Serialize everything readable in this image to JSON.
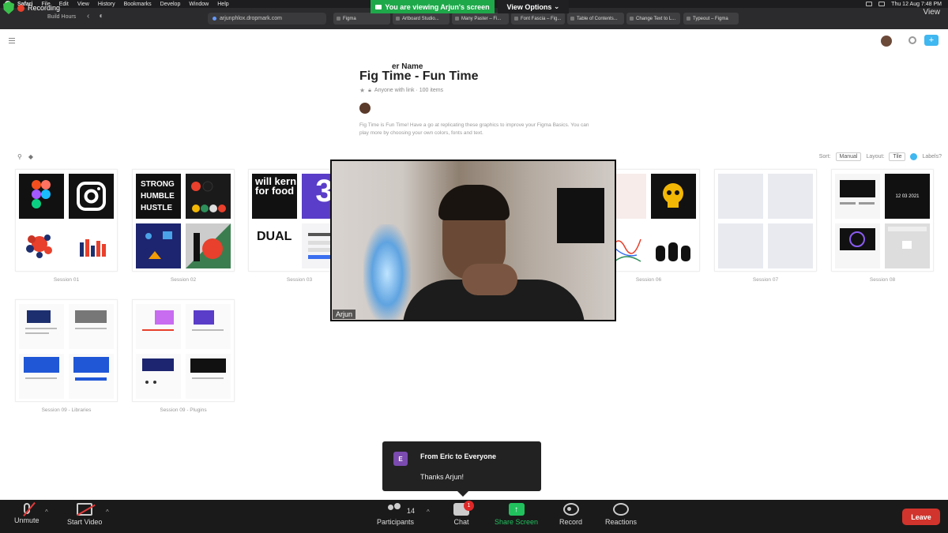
{
  "menubar": {
    "app": "Safari",
    "items": [
      "File",
      "Edit",
      "View",
      "History",
      "Bookmarks",
      "Develop",
      "Window",
      "Help"
    ],
    "clock": "Thu 12 Aug  7:48 PM"
  },
  "recording": {
    "label": "Recording"
  },
  "browser": {
    "sidebar_label": "Build Hours",
    "url": "arjunphlox.dropmark.com",
    "tabs": [
      "Figma",
      "Artboard Studio...",
      "Many Paster – Fi...",
      "Font Fascia – Fig...",
      "Table of Contents...",
      "Change Text to L...",
      "Typeout – Figma"
    ]
  },
  "zoom_share": {
    "banner": "You are viewing Arjun's screen",
    "view_options": "View Options",
    "view_button": "View"
  },
  "page": {
    "ghost_text": "er Name",
    "title": "Fig Time - Fun Time",
    "meta": "Anyone with link · 100 items",
    "description": "Fig Time is Fun Time! Have a go at replicating these graphics to improve your Figma Basics. You can play more by choosing your own colors, fonts and text.",
    "sort_label": "Sort:",
    "sort_value": "Manual",
    "layout_label": "Layout:",
    "layout_value": "Tile",
    "labels_toggle": "Labels?"
  },
  "collections": [
    {
      "label": "Session 01"
    },
    {
      "label": "Session 02"
    },
    {
      "label": "Session 03"
    },
    {
      "label": "Session 06"
    },
    {
      "label": "Session 07"
    },
    {
      "label": "Session 08"
    },
    {
      "label": "Session 09 - Libraries"
    },
    {
      "label": "Session 09 - Plugins"
    }
  ],
  "thumb_text": {
    "strong": "STRONG",
    "humble": "HUMBLE",
    "hustle": "HUSTLE",
    "will_kern": "will kern for food",
    "dual": "DUAL",
    "date": "12 03 2021"
  },
  "video": {
    "participant": "Arjun"
  },
  "chat_toast": {
    "avatar_initial": "E",
    "from": "From Eric to Everyone",
    "message": "Thanks Arjun!"
  },
  "controls": {
    "unmute": "Unmute",
    "start_video": "Start Video",
    "participants": "Participants",
    "participants_count": "14",
    "chat": "Chat",
    "chat_badge": "1",
    "share_screen": "Share Screen",
    "record": "Record",
    "reactions": "Reactions",
    "leave": "Leave"
  },
  "colors": {
    "share_green": "#1fa84a",
    "leave_red": "#d1342c",
    "dropmark_blue": "#3fb7f0"
  }
}
